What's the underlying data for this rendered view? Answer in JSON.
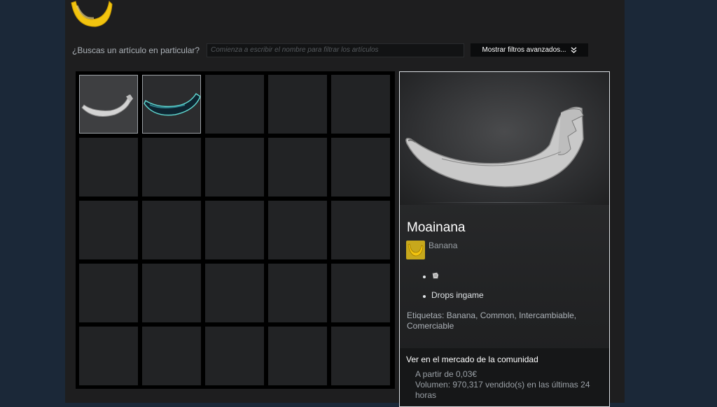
{
  "search": {
    "label": "¿Buscas un artículo en particular?",
    "placeholder": "Comienza a escribir el nombre para filtrar los artículos"
  },
  "filters_button": {
    "label": "Mostrar filtros avanzados...",
    "icon": "double-chevron-down-icon"
  },
  "inventory": {
    "columns": 5,
    "rows": 5,
    "items": [
      {
        "name": "moainana-gray-banana",
        "selected": true
      },
      {
        "name": "teal-banana",
        "selected": false
      }
    ]
  },
  "detail": {
    "item_name": "Moainana",
    "game_name": "Banana",
    "bullet_icon": "sticker-icon",
    "bullet_text": "Drops ingame",
    "tags": "Etiquetas: Banana, Common, Intercambiable, Comerciable",
    "market": {
      "title": "Ver en el mercado de la comunidad",
      "price": "A partir de 0,03€",
      "volume": "Volumen: 970,317 vendido(s) en las últimas 24 horas"
    }
  },
  "colors": {
    "background": "#1b2838",
    "panel": "#1e1e1f",
    "slot": "#222325",
    "accent_banana": "#f2c40f"
  }
}
